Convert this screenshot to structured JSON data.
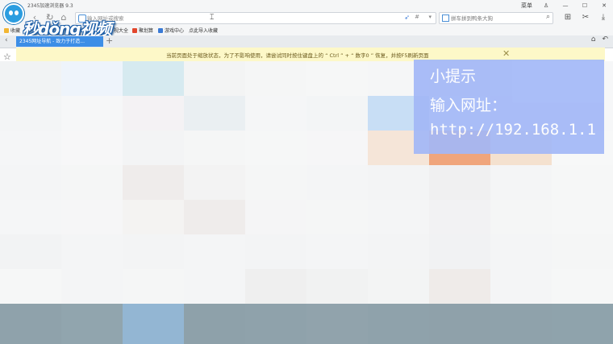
{
  "window": {
    "title": "2345加速浏览器 9.3",
    "menu_label": "菜单",
    "minimize_glyph": "—",
    "maximize_glyph": "☐",
    "close_glyph": "✕"
  },
  "nav": {
    "back_glyph": "‹",
    "forward_glyph": "›",
    "reload_glyph": "↻",
    "home_glyph": "⌂"
  },
  "address_bar": {
    "placeholder": "输入网址或搜索",
    "value": ""
  },
  "search_bar": {
    "text": "拼车拼到鸭条大狗"
  },
  "favorites": [
    {
      "label": "收藏"
    },
    {
      "label": "视大全"
    },
    {
      "label": "聚划算"
    },
    {
      "label": "游戏中心"
    },
    {
      "label": "点此导入收藏"
    }
  ],
  "watermark": {
    "text": "秒dǒng视频"
  },
  "tabs": [
    {
      "label": "2345网址导航 - 致力于打造..."
    }
  ],
  "notice": {
    "text": "当前页面处于缩放状态，为了不影响使用，请尝试同时按住键盘上的 “ Ctrl ” + “ 数字0 ” 恢复，并按F5刷新页面",
    "close_glyph": "✕"
  },
  "tip_overlay": {
    "line1": "小提示",
    "line2": "输入网址：",
    "line3": "http://192.168.1.1"
  },
  "colors": {
    "accent": "#3d8ee6",
    "notice_bg": "#fdf8c8",
    "tip_bg": "#a3b8f7"
  },
  "icons": [
    "star-icon",
    "shield-icon",
    "rocket-icon",
    "search-icon",
    "gear-icon",
    "scissors-icon",
    "download-icon",
    "briefcase-icon",
    "undo-icon"
  ]
}
